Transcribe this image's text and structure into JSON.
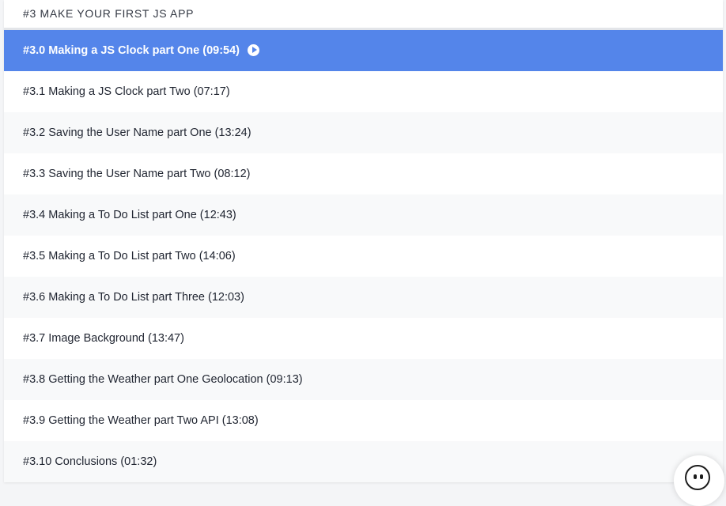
{
  "section": {
    "title": "#3 MAKE YOUR FIRST JS APP"
  },
  "lessons": [
    {
      "label": "#3.0 Making a JS Clock part One (09:54)",
      "active": true
    },
    {
      "label": "#3.1 Making a JS Clock part Two (07:17)"
    },
    {
      "label": "#3.2 Saving the User Name part One (13:24)"
    },
    {
      "label": "#3.3 Saving the User Name part Two (08:12)"
    },
    {
      "label": "#3.4 Making a To Do List part One (12:43)"
    },
    {
      "label": "#3.5 Making a To Do List part Two (14:06)"
    },
    {
      "label": "#3.6 Making a To Do List part Three (12:03)"
    },
    {
      "label": "#3.7 Image Background (13:47)"
    },
    {
      "label": "#3.8 Getting the Weather part One Geolocation (09:13)"
    },
    {
      "label": "#3.9 Getting the Weather part Two API (13:08)"
    },
    {
      "label": "#3.10 Conclusions (01:32)"
    }
  ],
  "icons": {
    "active_play": "play-circle-icon",
    "chat": "chat-face-icon"
  },
  "colors": {
    "accent": "#5485ea",
    "alt_row": "#f8f9fa"
  }
}
